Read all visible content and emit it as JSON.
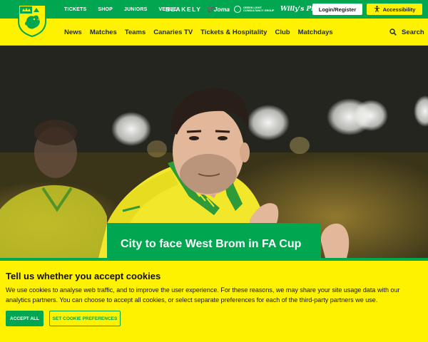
{
  "topbar": {
    "links": [
      "TICKETS",
      "SHOP",
      "JUNIORS",
      "VENUE"
    ],
    "sponsors": {
      "blakely": "BLAKELY",
      "joma": "Joma",
      "green_light_line1": "GREEN LIGHT",
      "green_light_line2": "CONSULTANCY GROUP",
      "willys": "Willy's Pies"
    },
    "login_label": "Login/Register",
    "accessibility_label": "Accessibility",
    "colors": {
      "green": "#00a650",
      "yellow": "#fff200"
    }
  },
  "nav": {
    "items": [
      "News",
      "Matches",
      "Teams",
      "Canaries TV",
      "Tickets & Hospitality",
      "Club",
      "Matchdays"
    ],
    "search_label": "Search"
  },
  "hero": {
    "headline": "City to face West Brom in FA Cup"
  },
  "cookie": {
    "title": "Tell us whether you accept cookies",
    "body": "We use cookies to analyse web traffic, and to improve the user experience. For these reasons, we may share your site usage data with our analytics partners. You can choose to accept all cookies, or select separate preferences for each of the third-party partners we use.",
    "accept_label": "ACCEPT ALL",
    "prefs_label": "SET COOKIE PREFERENCES"
  }
}
